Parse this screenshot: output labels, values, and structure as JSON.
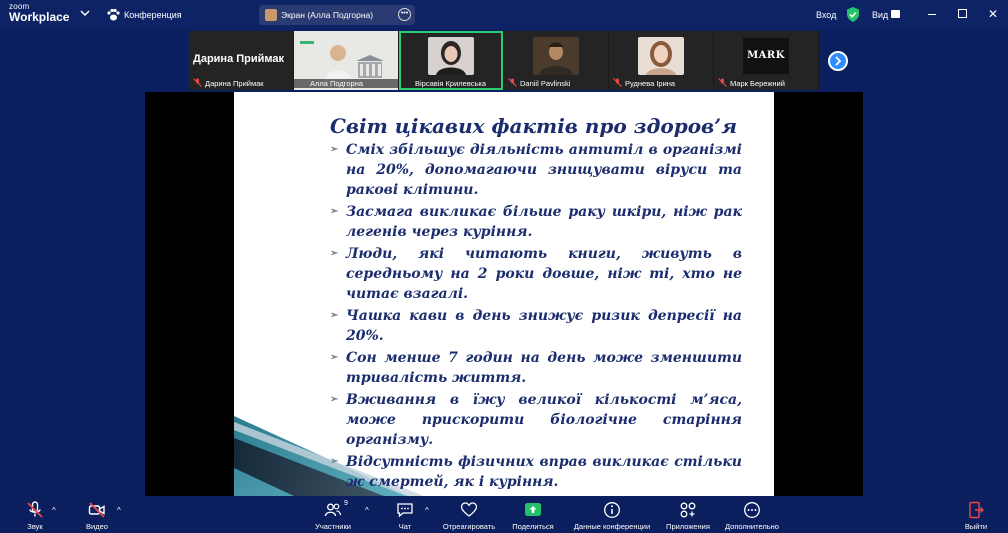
{
  "app": {
    "logo_line1": "zoom",
    "logo_line2": "Workplace",
    "meeting_title": "Конференция",
    "share_indicator": "Экран (Алла Подгорна)",
    "enter_label": "Вход",
    "view_label": "Вид"
  },
  "gallery": {
    "participants": [
      {
        "name": "Дарина Приймак",
        "display": "Дарина Приймак",
        "muted": true
      },
      {
        "name": "Алла Подгорна",
        "muted": false
      },
      {
        "name": "Вірсавія Крилевська",
        "muted": false,
        "active": true
      },
      {
        "name": "Daniil Pavlinski",
        "muted": true
      },
      {
        "name": "Руднева Ірина",
        "muted": true
      },
      {
        "name": "Марк Бережний",
        "display": "MARK",
        "muted": true
      }
    ]
  },
  "slide": {
    "title": "Світ цікавих фактів про здоров’я",
    "bullets": [
      "Сміх збільшує діяльність антитіл в організмі на 20%, допомагаючи знищувати віруси та ракові клітини.",
      "Засмага викликає більше раку шкіри, ніж рак легенів через куріння.",
      "Люди, які читають книги, живуть в середньому на 2 роки довше, ніж ті, хто не читає взагалі.",
      "Чашка кави в день знижує ризик депресії на 20%.",
      "Сон менше 7 годин на день може зменшити тривалість життя.",
      "Вживання в їжу великої кількості м’яса, може прискорити біологічне старіння організму.",
      "Відсутність фізичних вправ викликає стільки ж смертей, як і куріння."
    ]
  },
  "toolbar": {
    "audio": "Звук",
    "video": "Видео",
    "participants": "Участники",
    "participants_count": "9",
    "chat": "Чат",
    "react": "Отреагировать",
    "share": "Поделиться",
    "info": "Данные конференции",
    "apps": "Приложения",
    "more": "Дополнительно",
    "leave": "Выйти"
  },
  "colors": {
    "background": "#0b1f5e",
    "slide_text": "#1b2d6e",
    "share_green": "#23c26a",
    "mute_red": "#e54848",
    "accent_blue": "#2d8cff"
  }
}
